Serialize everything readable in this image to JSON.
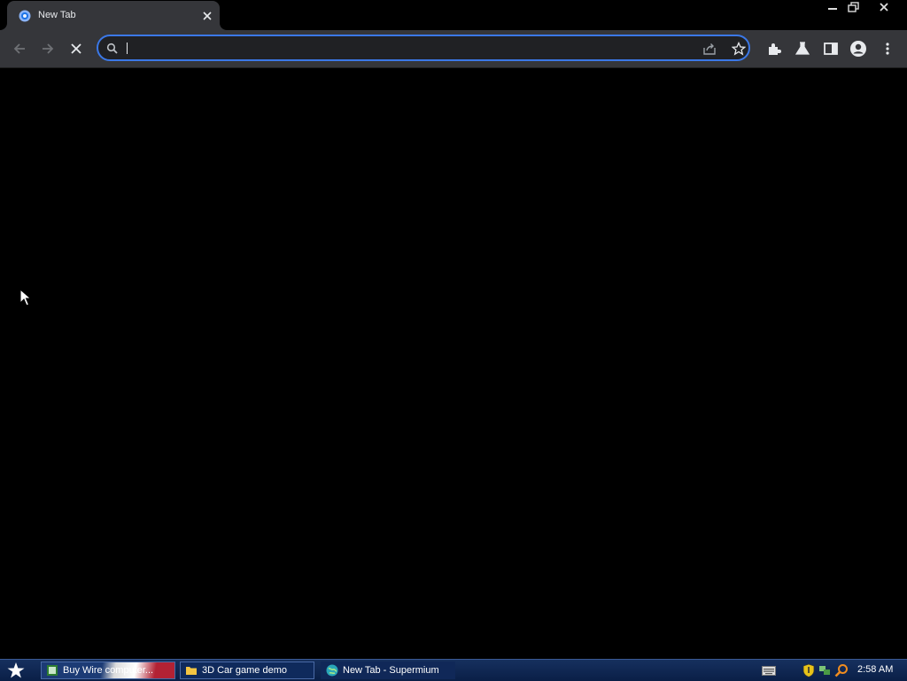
{
  "browser": {
    "tab": {
      "title": "New Tab"
    },
    "omnibox": {
      "value": "",
      "placeholder": ""
    }
  },
  "taskbar": {
    "tasks": [
      {
        "label": "Buy Wire computer..."
      },
      {
        "label": "3D Car game demo"
      },
      {
        "label": "New Tab - Supermium"
      }
    ],
    "clock": "2:58 AM"
  },
  "colors": {
    "accent": "#3b78e7",
    "toolbar": "#35363a",
    "page_background": "#000000"
  }
}
